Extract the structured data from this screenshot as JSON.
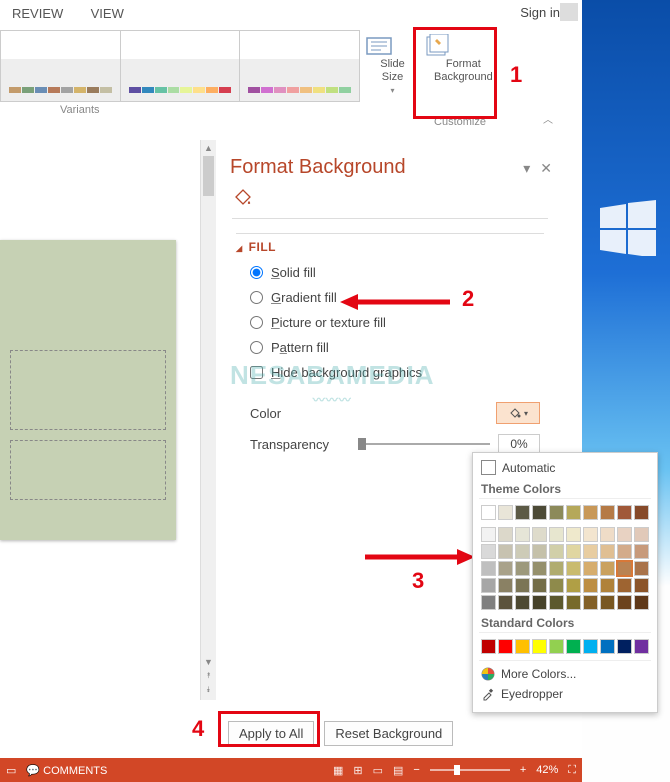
{
  "ribbon": {
    "tabs": [
      "REVIEW",
      "VIEW"
    ],
    "signin": "Sign in"
  },
  "variants": {
    "label": "Variants",
    "palettes": [
      [
        "#c39b6b",
        "#7aa079",
        "#6a8eb5",
        "#b77a5a",
        "#a3a3a3",
        "#d4b46a",
        "#9a7c5d",
        "#c4bfa4"
      ],
      [
        "#5e4fa2",
        "#3288bd",
        "#66c2a5",
        "#abdda4",
        "#e6f598",
        "#fee08b",
        "#fdae61",
        "#d53e4f"
      ],
      [
        "#a050a0",
        "#d070d0",
        "#e090c0",
        "#f0a0a0",
        "#f0c080",
        "#f0e080",
        "#c0e080",
        "#90d0a0"
      ]
    ]
  },
  "customize": {
    "slide_size": "Slide\nSize",
    "format_bg": "Format\nBackground",
    "label": "Customize"
  },
  "pane": {
    "title": "Format Background",
    "section_fill": "FILL",
    "opt_solid": "Solid fill",
    "opt_gradient": "Gradient fill",
    "opt_picture": "Picture or texture fill",
    "opt_pattern": "Pattern fill",
    "opt_hide": "Hide background graphics",
    "color_label": "Color",
    "transparency_label": "Transparency",
    "transparency_value": "0%",
    "apply_all": "Apply to All",
    "reset_bg": "Reset Background"
  },
  "colorpicker": {
    "automatic": "Automatic",
    "theme_head": "Theme Colors",
    "theme_top": [
      "#ffffff",
      "#e9e5d8",
      "#5c5a46",
      "#4c4a36",
      "#8c8a5a",
      "#b5a85a",
      "#c89858",
      "#b57a46",
      "#a05838",
      "#864a2a"
    ],
    "theme_shades": [
      [
        "#f2f2f2",
        "#dcd8ca",
        "#e6e5d7",
        "#dedbcb",
        "#e7e6cf",
        "#efe9cc",
        "#f3e5cf",
        "#efdcc7",
        "#e8d2c2",
        "#e1c9b9"
      ],
      [
        "#d9d9d9",
        "#c7c2b0",
        "#cdcbb7",
        "#c5c1aa",
        "#d1cfa8",
        "#e0d6a1",
        "#e8cda1",
        "#e0bf93",
        "#d3ab8a",
        "#c79a7b"
      ],
      [
        "#bfbfbf",
        "#a9a28a",
        "#9d997c",
        "#95906c",
        "#b0ac6f",
        "#c9bb6e",
        "#d6ad6d",
        "#caa15e",
        "#b98353",
        "#a9734a"
      ],
      [
        "#a6a6a6",
        "#8a8164",
        "#7b7555",
        "#736d48",
        "#8e8a4b",
        "#b09f45",
        "#bd8e43",
        "#b0823a",
        "#9e6431",
        "#8b5429"
      ],
      [
        "#7f7f7f",
        "#5b533d",
        "#4d4932",
        "#46422a",
        "#5c592e",
        "#776a2b",
        "#826028",
        "#785722",
        "#6c431e",
        "#5e3819"
      ]
    ],
    "std_head": "Standard Colors",
    "standard": [
      "#c00000",
      "#ff0000",
      "#ffc000",
      "#ffff00",
      "#92d050",
      "#00b050",
      "#00b0f0",
      "#0070c0",
      "#002060",
      "#7030a0"
    ],
    "more": "More Colors...",
    "eyedropper": "Eyedropper"
  },
  "statusbar": {
    "comments": "COMMENTS",
    "zoom": "42%"
  },
  "annotations": {
    "n1": "1",
    "n2": "2",
    "n3": "3",
    "n4": "4"
  },
  "watermark": "NESABAMEDIA"
}
